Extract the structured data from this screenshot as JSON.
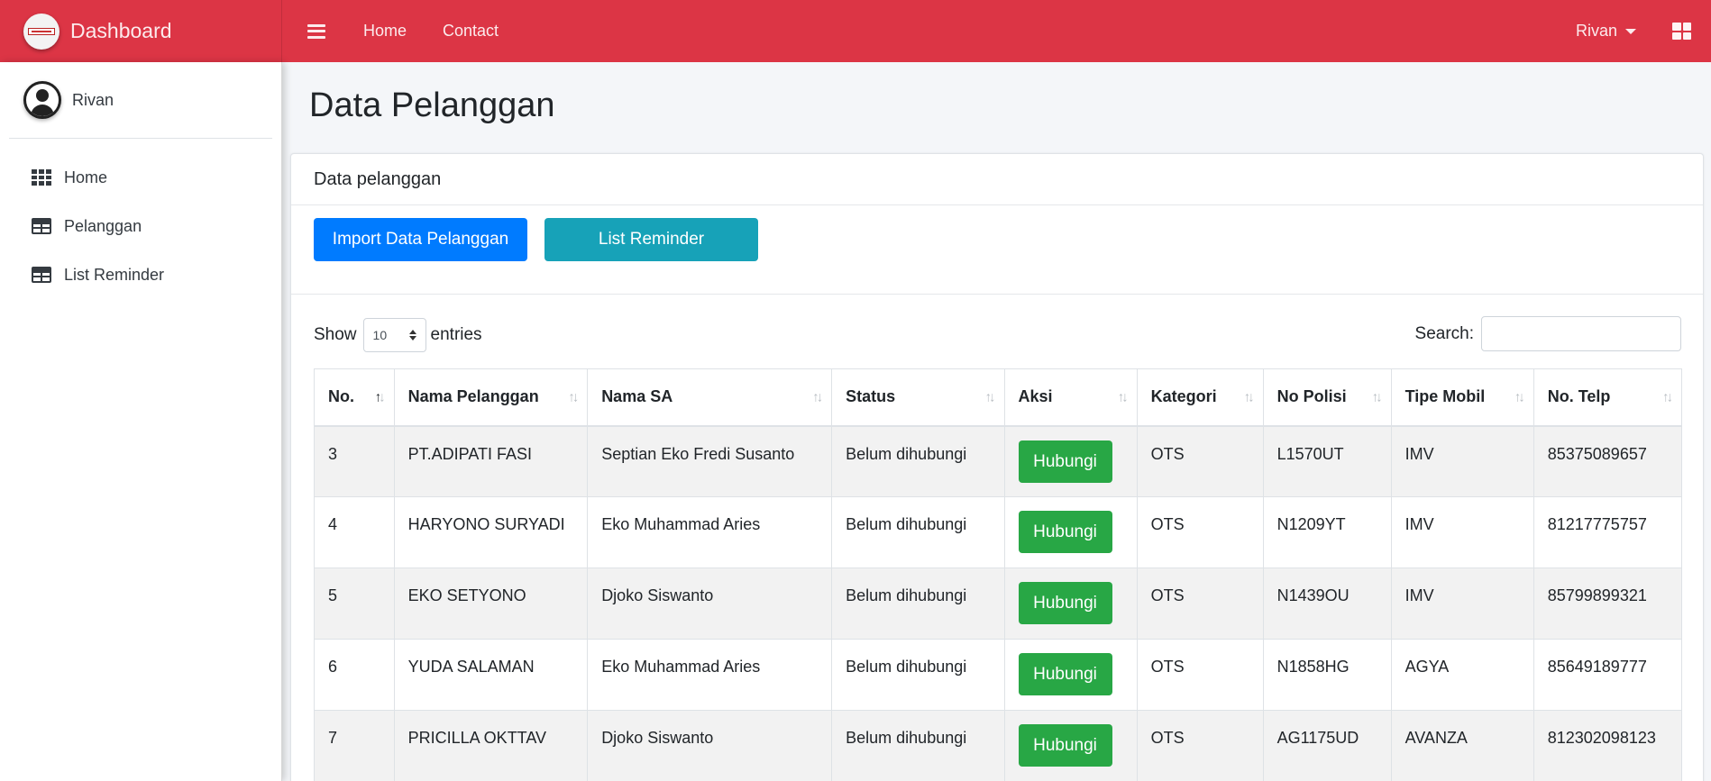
{
  "brand": {
    "title": "Dashboard"
  },
  "nav": {
    "links": [
      "Home",
      "Contact"
    ],
    "user": "Rivan"
  },
  "sidebar": {
    "user": "Rivan",
    "items": [
      {
        "label": "Home",
        "icon": "th-icon"
      },
      {
        "label": "Pelanggan",
        "icon": "table-icon"
      },
      {
        "label": "List Reminder",
        "icon": "table-icon"
      }
    ]
  },
  "page": {
    "title": "Data Pelanggan"
  },
  "card": {
    "header": "Data pelanggan",
    "import_label": "Import Data Pelanggan",
    "reminder_label": "List Reminder"
  },
  "datatable": {
    "show_label": "Show",
    "entries_value": "10",
    "entries_label": "entries",
    "search_label": "Search:",
    "search_value": ""
  },
  "table": {
    "columns": [
      "No.",
      "Nama Pelanggan",
      "Nama SA",
      "Status",
      "Aksi",
      "Kategori",
      "No Polisi",
      "Tipe Mobil",
      "No. Telp"
    ],
    "action_label": "Hubungi",
    "rows": [
      {
        "no": "3",
        "nama": "PT.ADIPATI FASI",
        "sa": "Septian Eko Fredi Susanto",
        "status": "Belum dihubungi",
        "kategori": "OTS",
        "polisi": "L1570UT",
        "tipe": "IMV",
        "telp": "85375089657"
      },
      {
        "no": "4",
        "nama": "HARYONO SURYADI",
        "sa": "Eko Muhammad Aries",
        "status": "Belum dihubungi",
        "kategori": "OTS",
        "polisi": "N1209YT",
        "tipe": "IMV",
        "telp": "81217775757"
      },
      {
        "no": "5",
        "nama": "EKO SETYONO",
        "sa": "Djoko Siswanto",
        "status": "Belum dihubungi",
        "kategori": "OTS",
        "polisi": "N1439OU",
        "tipe": "IMV",
        "telp": "85799899321"
      },
      {
        "no": "6",
        "nama": "YUDA SALAMAN",
        "sa": "Eko Muhammad Aries",
        "status": "Belum dihubungi",
        "kategori": "OTS",
        "polisi": "N1858HG",
        "tipe": "AGYA",
        "telp": "85649189777"
      },
      {
        "no": "7",
        "nama": "PRICILLA OKTTAV",
        "sa": "Djoko Siswanto",
        "status": "Belum dihubungi",
        "kategori": "OTS",
        "polisi": "AG1175UD",
        "tipe": "AVANZA",
        "telp": "812302098123"
      }
    ]
  },
  "colors": {
    "navbar": "#dc3545",
    "primary": "#007bff",
    "info": "#17a2b8",
    "success": "#28a745"
  }
}
